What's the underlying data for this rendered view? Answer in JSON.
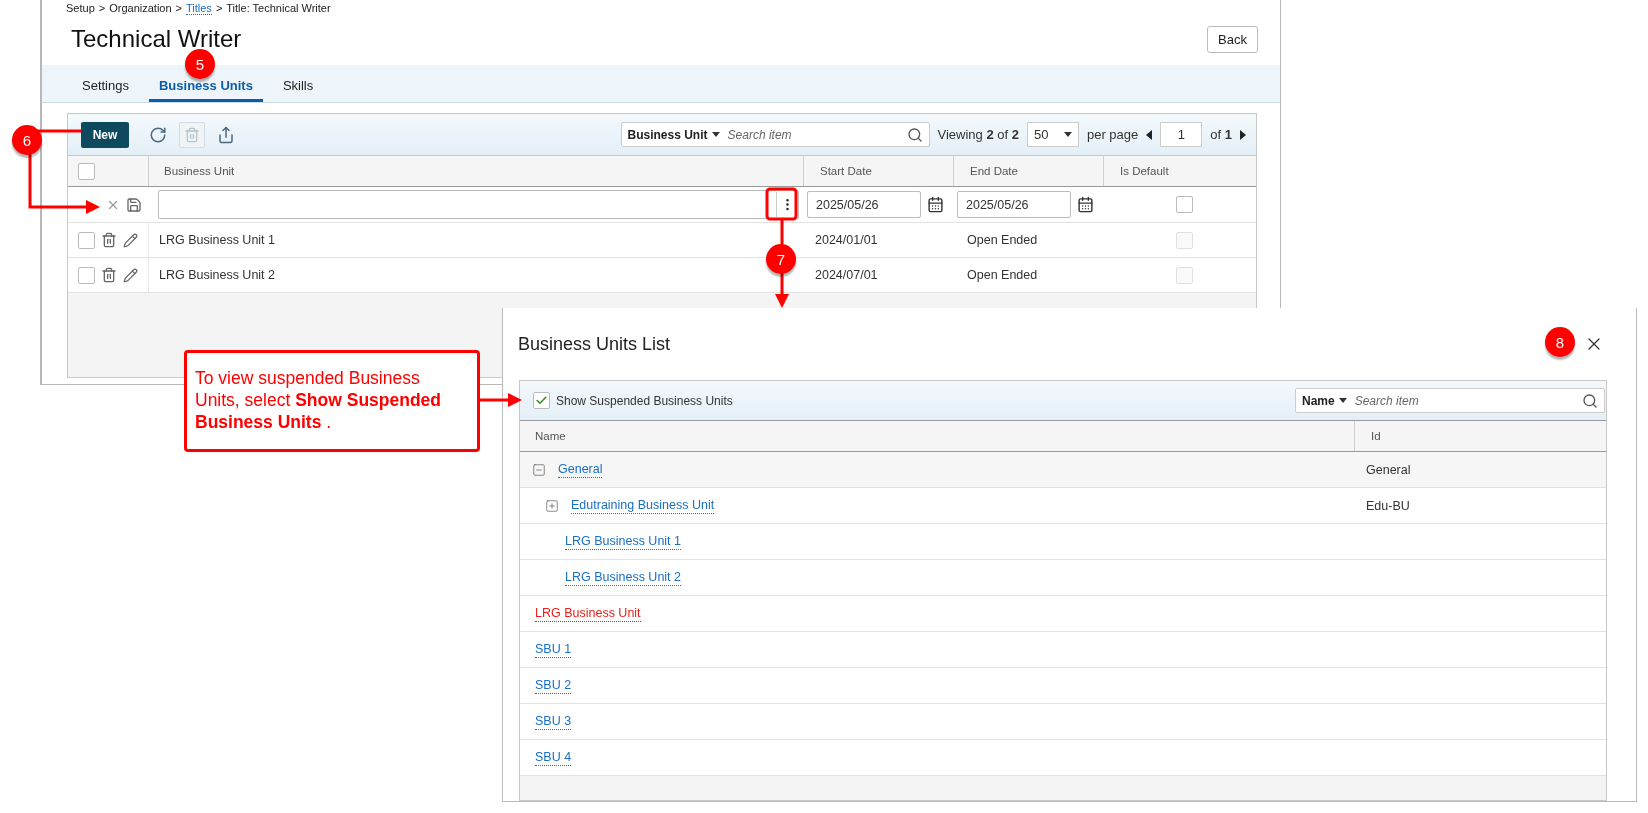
{
  "breadcrumb": {
    "separator": ">",
    "items": [
      {
        "label": "Setup",
        "link": false
      },
      {
        "label": "Organization",
        "link": false
      },
      {
        "label": "Titles",
        "link": true
      },
      {
        "label": "Title: Technical Writer",
        "link": false
      }
    ]
  },
  "page_title": "Technical Writer",
  "back_button": "Back",
  "tabs": [
    {
      "label": "Settings",
      "selected": false
    },
    {
      "label": "Business Units",
      "selected": true
    },
    {
      "label": "Skills",
      "selected": false
    }
  ],
  "toolbar": {
    "new_button": "New",
    "delete_disabled": true,
    "search": {
      "field": "Business Unit",
      "placeholder": "Search item"
    },
    "viewing": "Viewing **2** of **2**",
    "per_page_value": "50",
    "per_page_label": "per page",
    "page": "1",
    "page_total": "of **1**"
  },
  "table": {
    "select_all_checked": false,
    "columns": [
      "Business Unit",
      "Start Date",
      "End Date",
      "Is Default"
    ],
    "new_row": {
      "start_date": "2025/05/26",
      "end_date": "2025/05/26",
      "is_default": false
    },
    "rows": [
      {
        "checked": false,
        "business_unit": "LRG Business Unit 1",
        "start_date": "2024/01/01",
        "end_date": "Open Ended",
        "is_default": false
      },
      {
        "checked": false,
        "business_unit": "LRG Business Unit 2",
        "start_date": "2024/07/01",
        "end_date": "Open Ended",
        "is_default": false
      }
    ]
  },
  "dialog": {
    "title": "Business Units List",
    "show_suspended": {
      "label": "Show Suspended Business Units",
      "checked": true
    },
    "search": {
      "field": "Name",
      "placeholder": "Search item"
    },
    "columns": [
      "Name",
      "Id"
    ],
    "rows": [
      {
        "name": "General",
        "id": "General",
        "suspended": false,
        "expanded": true,
        "children": [
          {
            "name": "Edutraining Business Unit",
            "id": "Edu-BU",
            "suspended": false,
            "expanded": false
          },
          {
            "name": "LRG Business Unit 1",
            "suspended": false
          },
          {
            "name": "LRG Business Unit 2",
            "suspended": false
          }
        ]
      },
      {
        "name": "LRG Business Unit",
        "suspended": true
      },
      {
        "name": "SBU 1",
        "suspended": false
      },
      {
        "name": "SBU 2",
        "suspended": false
      },
      {
        "name": "SBU 3",
        "suspended": false
      },
      {
        "name": "SBU 4",
        "suspended": false
      }
    ]
  },
  "annotations": {
    "badges": [
      "5",
      "6",
      "7",
      "8"
    ],
    "callout": "To view suspended Business Units, select **Show Suspended Business Units** ."
  }
}
